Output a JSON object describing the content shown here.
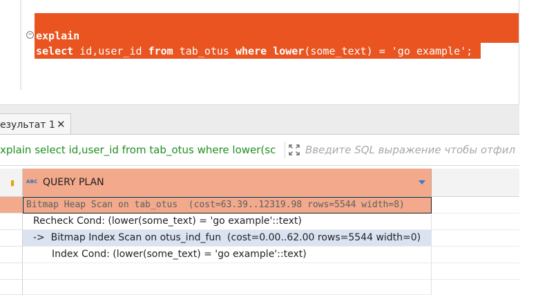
{
  "editor": {
    "fold_marker": "⊖",
    "line1": {
      "keyword": "explain"
    },
    "line2": {
      "kw_select": "select",
      "t1": " id,user_id ",
      "kw_from": "from",
      "t2": " tab_otus ",
      "kw_where": "where",
      "t3": " ",
      "kw_lower": "lower",
      "t4": "(some_text) = 'go example';"
    },
    "selection_color": "#e95420"
  },
  "result_tab": {
    "label": "езультат 1",
    "close": "✕"
  },
  "filter_bar": {
    "query_text": "xplain select id,user_id from tab_otus where lower(sc",
    "placeholder": "Введите SQL выражение чтобы отфил"
  },
  "grid": {
    "column": {
      "type_badge": "ABC",
      "name": "QUERY PLAN"
    },
    "rows": [
      {
        "text": "Bitmap Heap Scan on tab_otus  (cost=63.39..12319.98 rows=5544 width=8)"
      },
      {
        "text": "Recheck Cond: (lower(some_text) = 'go example'::text)"
      },
      {
        "text": "->  Bitmap Index Scan on otus_ind_fun  (cost=0.00..62.00 rows=5544 width=0)"
      },
      {
        "text": "Index Cond: (lower(some_text) = 'go example'::text)"
      },
      {
        "text": ""
      }
    ],
    "selected_color": "#f2a98c",
    "alt_row_color": "#dbe3f2"
  }
}
